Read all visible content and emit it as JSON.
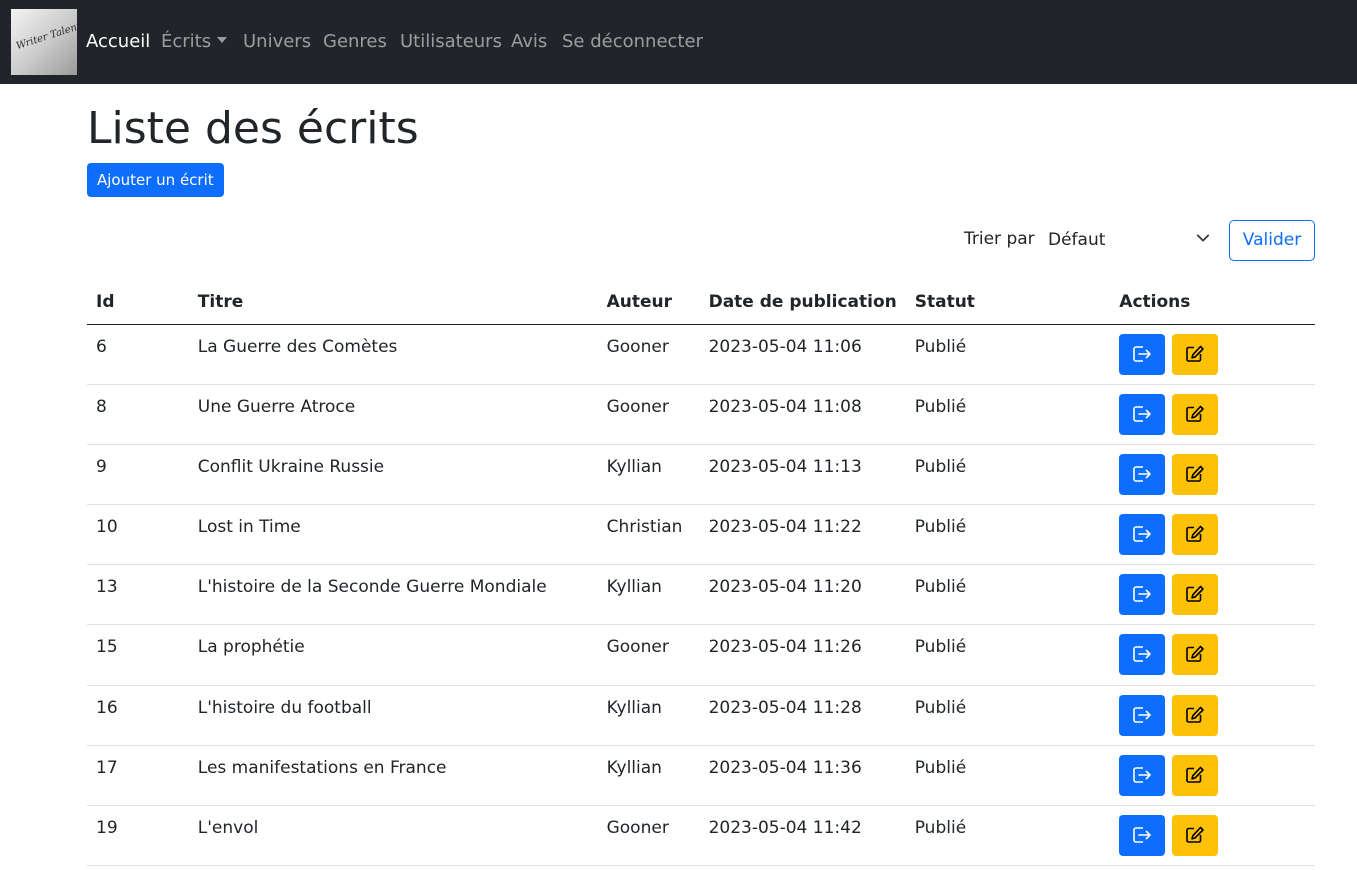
{
  "nav": {
    "logo_text": "Writer Talent",
    "links": [
      {
        "label": "Accueil"
      },
      {
        "label": "Écrits"
      },
      {
        "label": "Univers"
      },
      {
        "label": "Genres"
      },
      {
        "label": "Utilisateurs"
      },
      {
        "label": "Avis"
      },
      {
        "label": "Se déconnecter"
      }
    ]
  },
  "page": {
    "title": "Liste des écrits",
    "add_button": "Ajouter un écrit"
  },
  "sort": {
    "label": "Trier par",
    "selected": "Défaut",
    "submit": "Valider"
  },
  "table": {
    "headers": [
      "Id",
      "Titre",
      "Auteur",
      "Date de publication",
      "Statut",
      "Actions"
    ],
    "rows": [
      {
        "id": "6",
        "titre": "La Guerre des Comètes",
        "auteur": "Gooner",
        "date": "2023-05-04 11:06",
        "statut": "Publié"
      },
      {
        "id": "8",
        "titre": "Une Guerre Atroce",
        "auteur": "Gooner",
        "date": "2023-05-04 11:08",
        "statut": "Publié"
      },
      {
        "id": "9",
        "titre": "Conflit Ukraine Russie",
        "auteur": "Kyllian",
        "date": "2023-05-04 11:13",
        "statut": "Publié"
      },
      {
        "id": "10",
        "titre": "Lost in Time",
        "auteur": "Christian",
        "date": "2023-05-04 11:22",
        "statut": "Publié"
      },
      {
        "id": "13",
        "titre": "L'histoire de la Seconde Guerre Mondiale",
        "auteur": "Kyllian",
        "date": "2023-05-04 11:20",
        "statut": "Publié"
      },
      {
        "id": "15",
        "titre": "La prophétie",
        "auteur": "Gooner",
        "date": "2023-05-04 11:26",
        "statut": "Publié"
      },
      {
        "id": "16",
        "titre": "L'histoire du football",
        "auteur": "Kyllian",
        "date": "2023-05-04 11:28",
        "statut": "Publié"
      },
      {
        "id": "17",
        "titre": "Les manifestations en France",
        "auteur": "Kyllian",
        "date": "2023-05-04 11:36",
        "statut": "Publié"
      },
      {
        "id": "19",
        "titre": "L'envol",
        "auteur": "Gooner",
        "date": "2023-05-04 11:42",
        "statut": "Publié"
      }
    ]
  },
  "colors": {
    "navbar": "#212529",
    "primary": "#0d6efd",
    "warning": "#ffc107"
  },
  "icons": {
    "view": "box-arrow-right-icon",
    "edit": "pencil-square-icon"
  }
}
